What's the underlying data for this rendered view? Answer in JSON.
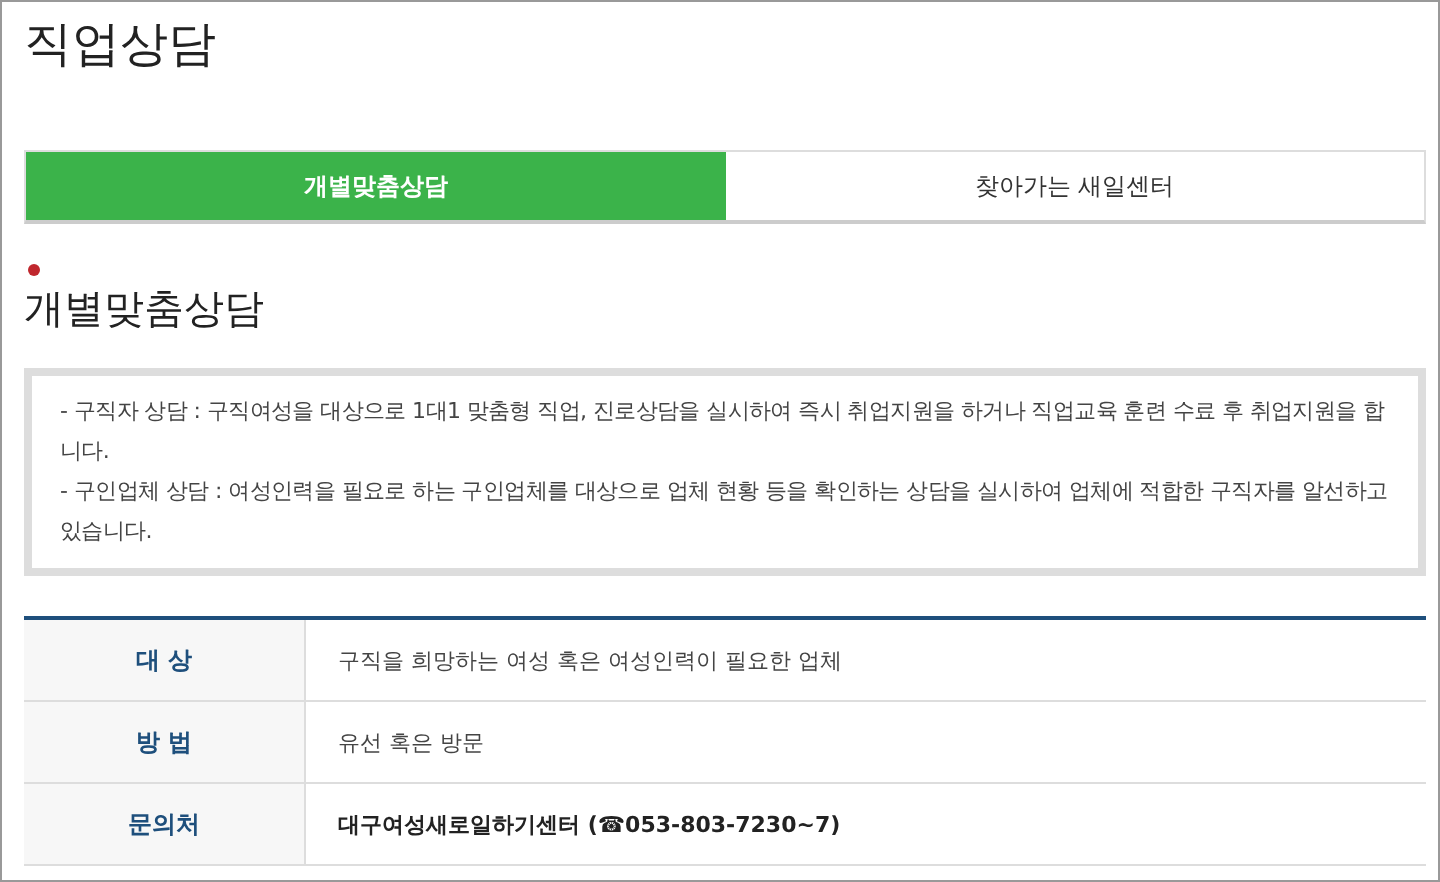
{
  "page_title": "직업상담",
  "tabs": [
    {
      "label": "개별맞춤상담",
      "selected": true
    },
    {
      "label": "찾아가는 새일센터",
      "selected": false
    }
  ],
  "section_title": "개별맞춤상담",
  "description": [
    "- 구직자 상담 : 구직여성을 대상으로 1대1 맞춤형 직업, 진로상담을 실시하여 즉시 취업지원을 하거나 직업교육 훈련 수료 후 취업지원을 합니다.",
    "- 구인업체 상담 : 여성인력을 필요로 하는 구인업체를 대상으로 업체 현황 등을 확인하는 상담을 실시하여 업체에 적합한 구직자를 알선하고 있습니다."
  ],
  "table": {
    "rows": [
      {
        "label": "대 상",
        "value": "구직을 희망하는 여성 혹은 여성인력이 필요한 업체",
        "bold": false
      },
      {
        "label": "방 법",
        "value": "유선 혹은 방문",
        "bold": false
      },
      {
        "label": "문의처",
        "value": "대구여성새로일하기센터 (☎053-803-7230~7)",
        "bold": true
      }
    ]
  }
}
